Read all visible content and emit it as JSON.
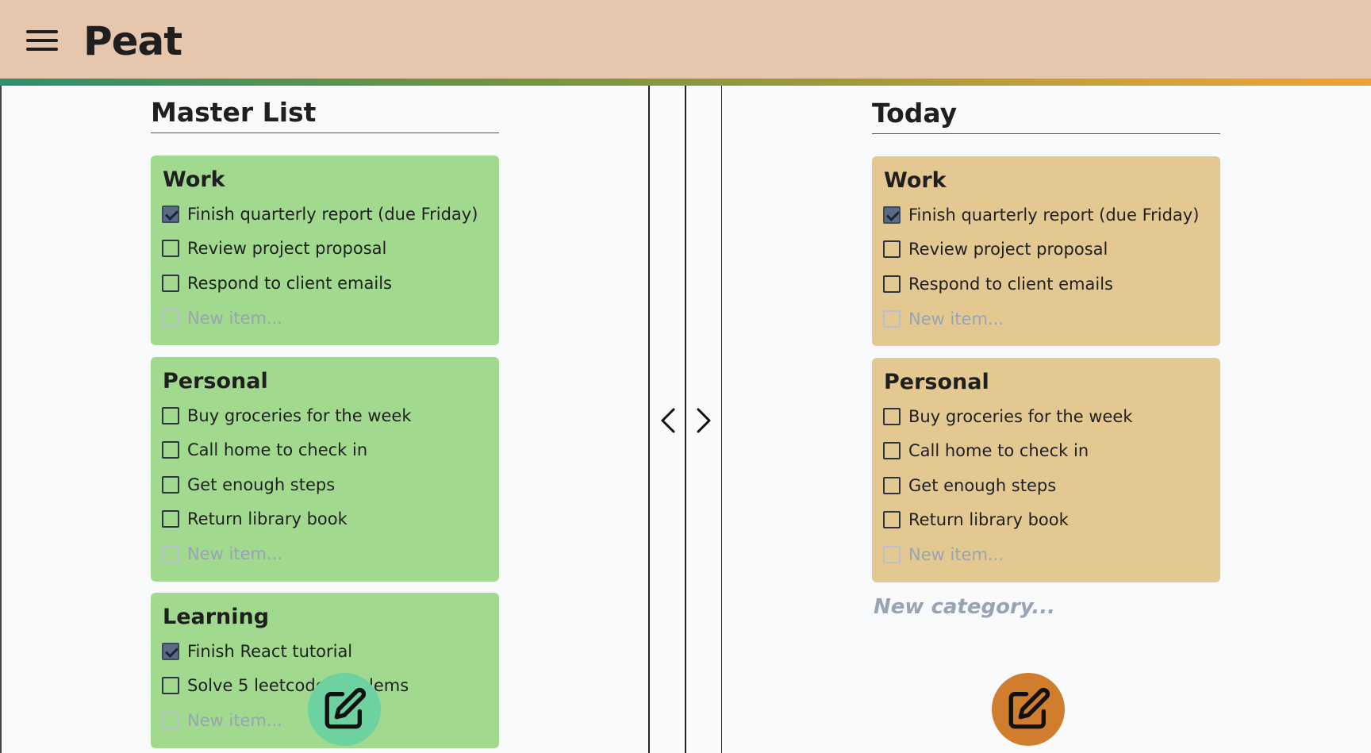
{
  "app": {
    "title": "Peat"
  },
  "master": {
    "title": "Master List",
    "categories": [
      {
        "name": "Work",
        "items": [
          {
            "text": "Finish quarterly report (due Friday)",
            "checked": true
          },
          {
            "text": "Review project proposal",
            "checked": false
          },
          {
            "text": "Respond to client emails",
            "checked": false
          }
        ],
        "new_item_placeholder": "New item..."
      },
      {
        "name": "Personal",
        "items": [
          {
            "text": "Buy groceries for the week",
            "checked": false
          },
          {
            "text": "Call home to check in",
            "checked": false
          },
          {
            "text": "Get enough steps",
            "checked": false
          },
          {
            "text": "Return library book",
            "checked": false
          }
        ],
        "new_item_placeholder": "New item..."
      },
      {
        "name": "Learning",
        "items": [
          {
            "text": "Finish React tutorial",
            "checked": true
          },
          {
            "text": "Solve 5 leetcode problems",
            "checked": false
          }
        ],
        "new_item_placeholder": "New item..."
      }
    ]
  },
  "today": {
    "title": "Today",
    "categories": [
      {
        "name": "Work",
        "items": [
          {
            "text": "Finish quarterly report (due Friday)",
            "checked": true
          },
          {
            "text": "Review project proposal",
            "checked": false
          },
          {
            "text": "Respond to client emails",
            "checked": false
          }
        ],
        "new_item_placeholder": "New item..."
      },
      {
        "name": "Personal",
        "items": [
          {
            "text": "Buy groceries for the week",
            "checked": false
          },
          {
            "text": "Call home to check in",
            "checked": false
          },
          {
            "text": "Get enough steps",
            "checked": false
          },
          {
            "text": "Return library book",
            "checked": false
          }
        ],
        "new_item_placeholder": "New item..."
      }
    ],
    "new_category_placeholder": "New category..."
  },
  "icons": {
    "menu": "hamburger-menu-icon",
    "prev": "chevron-left-icon",
    "next": "chevron-right-icon",
    "edit": "edit-pencil-icon"
  },
  "colors": {
    "header": "#e7c6ae",
    "master_card": "#a1da8e",
    "today_card": "#e4c891",
    "master_fab": "#6ed1a0",
    "today_fab": "#d07e2d"
  }
}
